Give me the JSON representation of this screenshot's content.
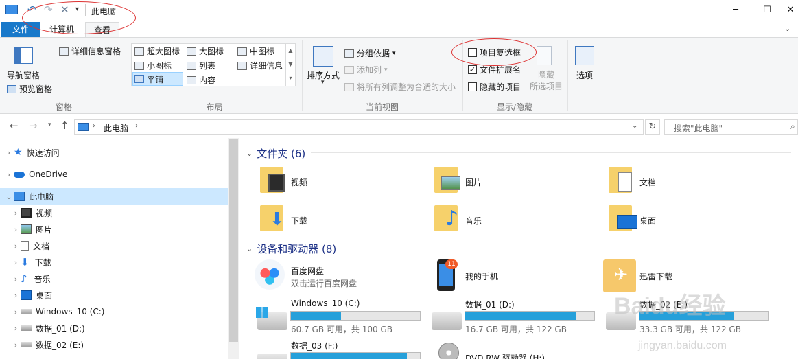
{
  "titlebar": {
    "title": "此电脑",
    "minimize": "─",
    "maximize": "☐",
    "close": "✕"
  },
  "tabs": {
    "file": "文件",
    "computer": "计算机",
    "view": "查看"
  },
  "ribbon": {
    "panes": {
      "navigation_pane": "导航窗格",
      "preview_pane": "预览窗格",
      "details_pane": "详细信息窗格",
      "group_label": "窗格"
    },
    "layout": {
      "extra_large_icons": "超大图标",
      "large_icons": "大图标",
      "medium_icons": "中图标",
      "small_icons": "小图标",
      "list": "列表",
      "details": "详细信息",
      "tiles": "平铺",
      "content": "内容",
      "group_label": "布局"
    },
    "current_view": {
      "sort_by": "排序方式",
      "group_by": "分组依据",
      "add_columns": "添加列",
      "size_all_columns": "将所有列调整为合适的大小",
      "group_label": "当前视图"
    },
    "show_hide": {
      "item_check_boxes": "项目复选框",
      "file_name_extensions": "文件扩展名",
      "hidden_items": "隐藏的项目",
      "hide_selected_items_1": "隐藏",
      "hide_selected_items_2": "所选项目",
      "group_label": "显示/隐藏",
      "item_check_boxes_checked": false,
      "file_name_extensions_checked": true,
      "hidden_items_checked": false
    },
    "options": "选项"
  },
  "addressbar": {
    "path_root": "此电脑",
    "search_placeholder": "搜索\"此电脑\""
  },
  "sidebar": {
    "items": [
      {
        "label": "快速访问"
      },
      {
        "label": "OneDrive"
      },
      {
        "label": "此电脑"
      },
      {
        "label": "视频"
      },
      {
        "label": "图片"
      },
      {
        "label": "文档"
      },
      {
        "label": "下载"
      },
      {
        "label": "音乐"
      },
      {
        "label": "桌面"
      },
      {
        "label": "Windows_10 (C:)"
      },
      {
        "label": "数据_01 (D:)"
      },
      {
        "label": "数据_02 (E:)"
      }
    ]
  },
  "content": {
    "folders_header": "文件夹 (6)",
    "folders": [
      {
        "label": "视频"
      },
      {
        "label": "图片"
      },
      {
        "label": "文档"
      },
      {
        "label": "下载"
      },
      {
        "label": "音乐"
      },
      {
        "label": "桌面"
      }
    ],
    "devices_header": "设备和驱动器 (8)",
    "devices": [
      {
        "label": "百度网盘",
        "sub": "双击运行百度网盘"
      },
      {
        "label": "我的手机",
        "badge": "11"
      },
      {
        "label": "迅雷下载"
      }
    ],
    "drives": [
      {
        "label": "Windows_10 (C:)",
        "sub": "60.7 GB 可用，共 100 GB",
        "used_fraction": 0.39
      },
      {
        "label": "数据_01 (D:)",
        "sub": "16.7 GB 可用，共 122 GB",
        "used_fraction": 0.86
      },
      {
        "label": "数据_02 (E:)",
        "sub": "33.3 GB 可用，共 122 GB",
        "used_fraction": 0.73
      },
      {
        "label": "数据_03 (F:)",
        "used_fraction": 0.9
      },
      {
        "label": "DVD RW 驱动器 (H:)"
      }
    ]
  },
  "watermark": {
    "text": "Baidu经验",
    "url": "jingyan.baidu.com"
  },
  "colors": {
    "accent": "#1979ca",
    "selection": "#cce8ff",
    "header_text": "#1e3287",
    "drive_fill": "#26a0da"
  }
}
